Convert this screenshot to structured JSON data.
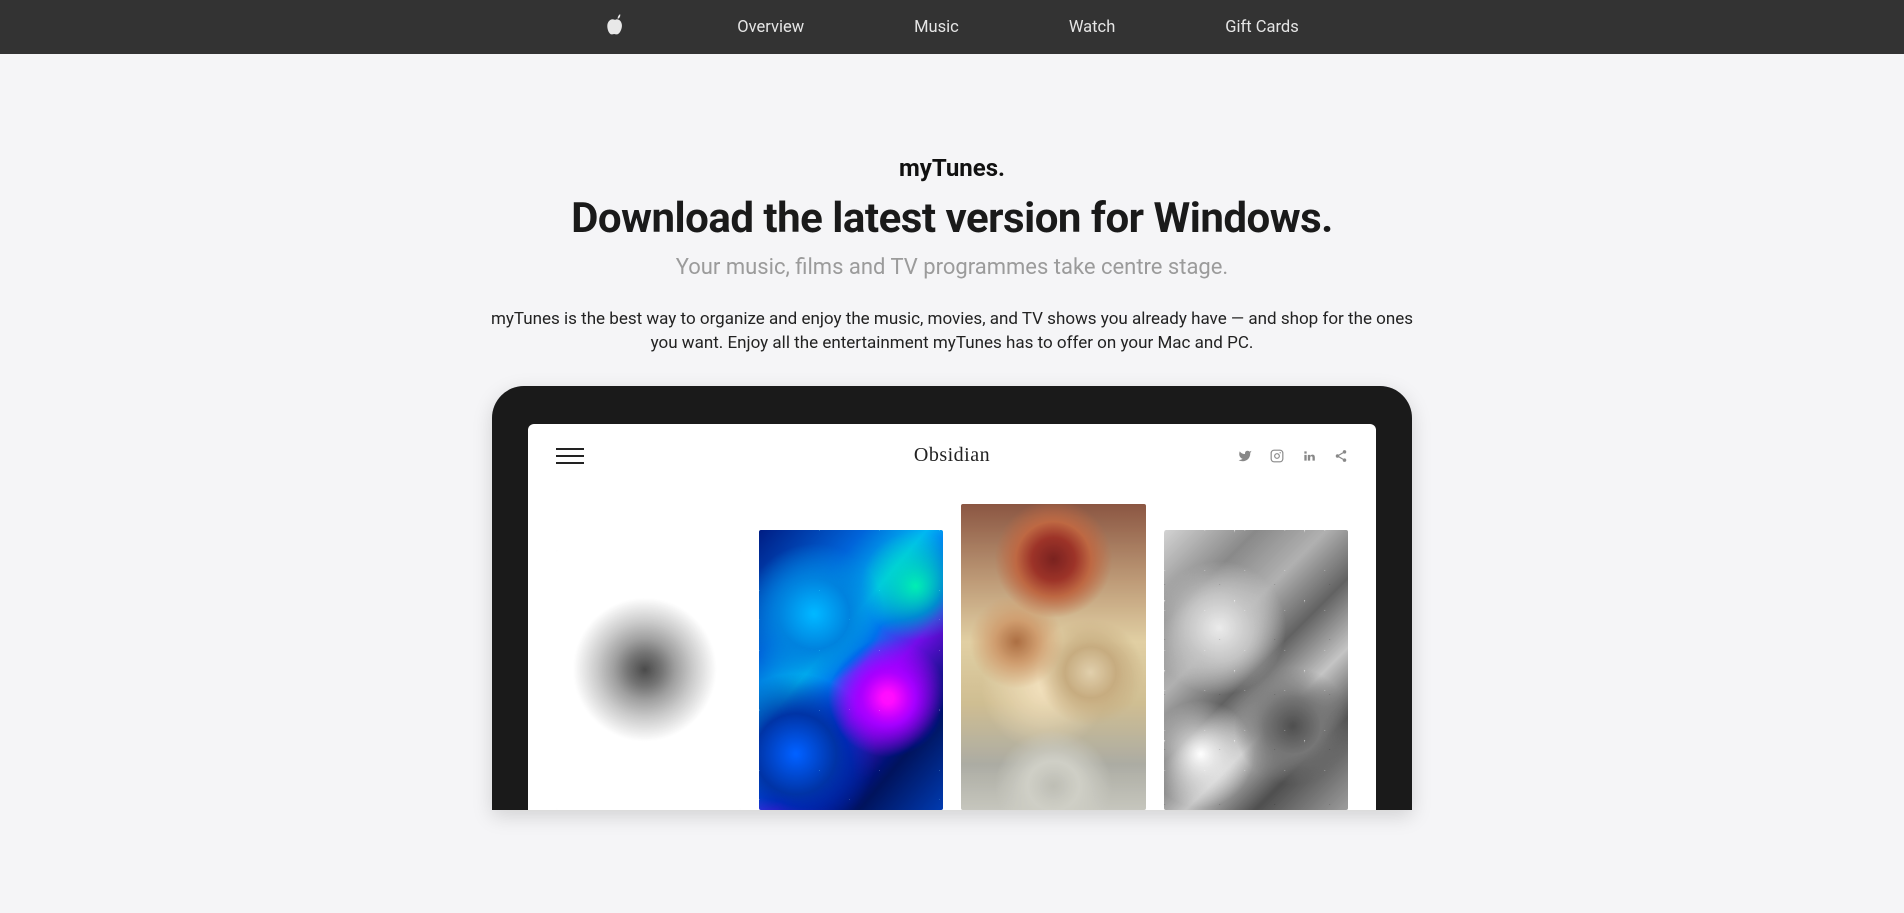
{
  "nav": {
    "items": [
      {
        "label": "Overview"
      },
      {
        "label": "Music"
      },
      {
        "label": "Watch"
      },
      {
        "label": "Gift Cards"
      }
    ]
  },
  "hero": {
    "brand": "myTunes.",
    "headline": "Download the latest version for Windows.",
    "subhead": "Your music, films and TV programmes take centre stage.",
    "description": "myTunes is the best way to organize and enjoy the music, movies, and TV shows you already have — and shop for the ones you want. Enjoy all the entertainment myTunes has to offer on your Mac and PC."
  },
  "device": {
    "screen_title": "Obsidian"
  }
}
